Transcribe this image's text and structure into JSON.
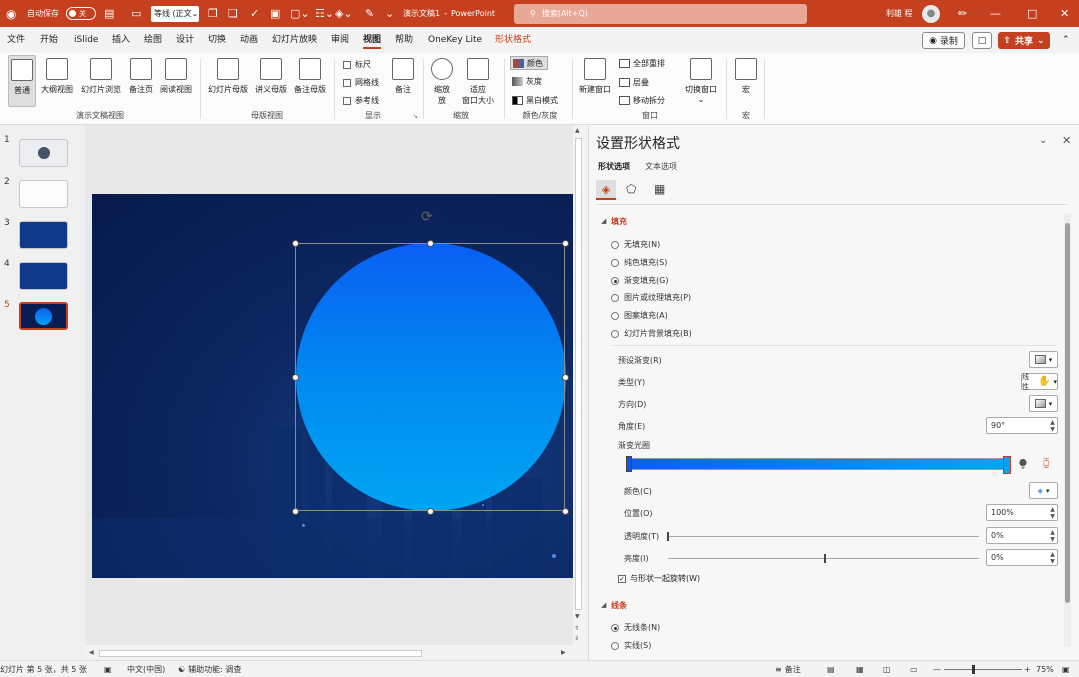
{
  "titlebar": {
    "autosave_label": "自动保存",
    "autosave_state": "关",
    "font_box": "等线 (正文",
    "doc_title": "演示文稿1",
    "app_name": "PowerPoint",
    "search_placeholder": "搜索(Alt+Q)",
    "user_name": "利雄 程"
  },
  "menu": {
    "tabs": [
      "文件",
      "开始",
      "iSlide",
      "插入",
      "绘图",
      "设计",
      "切换",
      "动画",
      "幻灯片放映",
      "审阅",
      "视图",
      "帮助",
      "OneKey Lite",
      "形状格式"
    ],
    "active_tab": "视图",
    "record_label": "录制",
    "share_label": "共享"
  },
  "ribbon": {
    "pres_views": {
      "buttons": [
        "普通",
        "大纲视图",
        "幻灯片浏览",
        "备注页",
        "阅读视图"
      ],
      "group": "演示文稿视图"
    },
    "master_views": {
      "buttons": [
        "幻灯片母版",
        "讲义母版",
        "备注母版"
      ],
      "group": "母版视图"
    },
    "show": {
      "checks": [
        "标尺",
        "网格线",
        "参考线"
      ],
      "notes_label": "备注",
      "group": "显示"
    },
    "zoom": {
      "zoom_label": "缩放",
      "zoom_label_2": "放",
      "fit_label": "适应",
      "fit_label_2": "窗口大小",
      "group": "缩放"
    },
    "color": {
      "buttons": [
        "颜色",
        "灰度",
        "黑白模式"
      ],
      "group": "颜色/灰度"
    },
    "window": {
      "new_window": "新建窗口",
      "items": [
        "全部重排",
        "层叠",
        "移动拆分"
      ],
      "switch_window": "切换窗口",
      "group": "窗口"
    },
    "macros": {
      "label": "宏",
      "group": "宏"
    }
  },
  "slides": {
    "numbers": [
      "1",
      "2",
      "3",
      "4",
      "5"
    ],
    "current": 5
  },
  "panel": {
    "title": "设置形状格式",
    "tab_shape": "形状选项",
    "tab_text": "文本选项",
    "fill_section": "填充",
    "fill_options": [
      "无填充(N)",
      "纯色填充(S)",
      "渐变填充(G)",
      "图片或纹理填充(P)",
      "图案填充(A)",
      "幻灯片背景填充(B)"
    ],
    "fill_selected": "渐变填充(G)",
    "preset_label": "预设渐变(R)",
    "type_label": "类型(Y)",
    "type_value": "线性",
    "direction_label": "方向(D)",
    "angle_label": "角度(E)",
    "angle_value": "90°",
    "stops_label": "渐变光圈",
    "color_label": "颜色(C)",
    "position_label": "位置(O)",
    "position_value": "100%",
    "transparency_label": "透明度(T)",
    "transparency_value": "0%",
    "brightness_label": "亮度(I)",
    "brightness_value": "0%",
    "rotate_label": "与形状一起旋转(W)",
    "line_section": "线条",
    "line_options": [
      "无线条(N)",
      "实线(S)"
    ],
    "line_selected": "无线条(N)"
  },
  "statusbar": {
    "slide_info": "幻灯片 第 5 张，共 5 张",
    "language": "中文(中国)",
    "accessibility": "辅助功能: 调查",
    "notes": "备注",
    "zoom": "75%"
  },
  "colors": {
    "brand": "#c4401f",
    "gradient_top": "#0a5ff2",
    "gradient_bottom": "#00a5f2",
    "slide_bg": "#061a4b"
  }
}
